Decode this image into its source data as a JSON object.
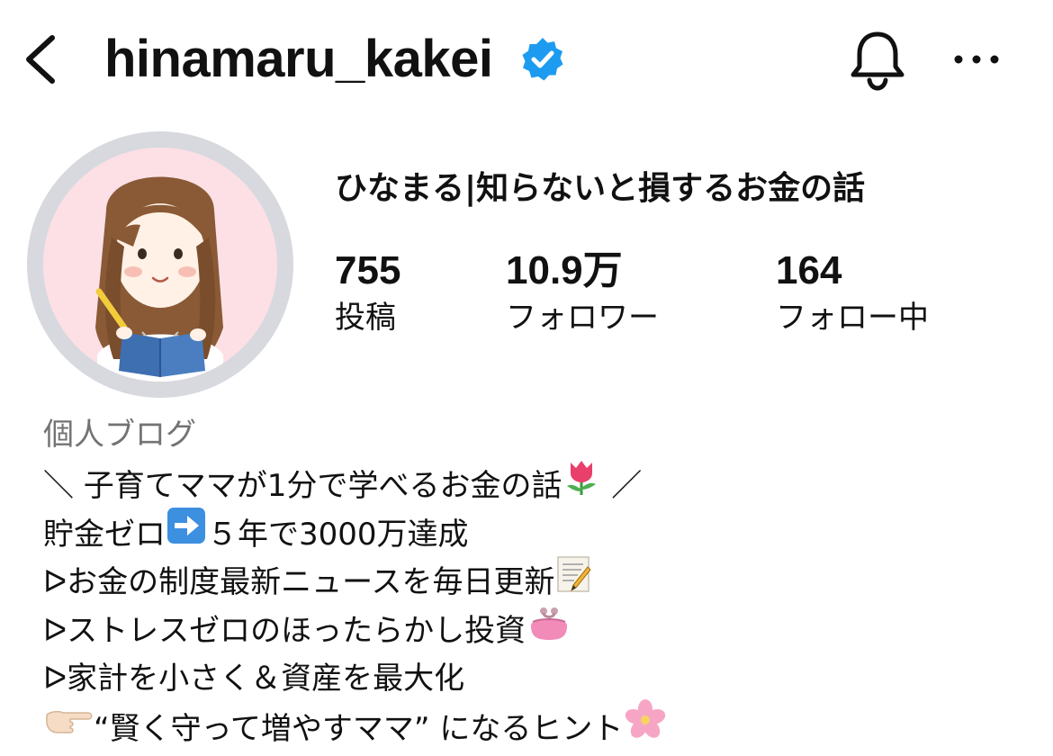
{
  "header": {
    "username": "hinamaru_kakei",
    "verified_icon": "verified-badge-icon",
    "back_icon": "chevron-left-icon",
    "bell_icon": "bell-icon",
    "more_icon": "more-horizontal-icon",
    "accent_color": "#1d9bf0"
  },
  "profile": {
    "display_name": "ひなまる|知らないと損するお金の話",
    "avatar": "avatar-illustration",
    "stats": [
      {
        "value": "755",
        "label": "投稿"
      },
      {
        "value": "10.9万",
        "label": "フォロワー"
      },
      {
        "value": "164",
        "label": "フォロー中"
      }
    ]
  },
  "bio": {
    "category": "個人ブログ",
    "lines": [
      {
        "prefix": "＼ 子育てママが1分で学べるお金の話",
        "emoji": "tulip-emoji",
        "suffix": " ／"
      },
      {
        "prefix": "貯金ゼロ",
        "emoji": "right-arrow-emoji",
        "suffix": "５年で3000万達成"
      },
      {
        "prefix": "ᐅお金の制度最新ニュースを毎日更新",
        "emoji": "memo-emoji",
        "suffix": ""
      },
      {
        "prefix": "ᐅストレスゼロのほったらかし投資",
        "emoji": "purse-emoji",
        "suffix": ""
      },
      {
        "prefix": "ᐅ家計を小さく＆資産を最大化",
        "emoji": "",
        "suffix": ""
      },
      {
        "prefix": "",
        "emoji": "pointing-hand-emoji",
        "suffix": "“賢く守って増やすママ” になるヒント",
        "trailing_emoji": "cherry-blossom-emoji"
      }
    ]
  }
}
